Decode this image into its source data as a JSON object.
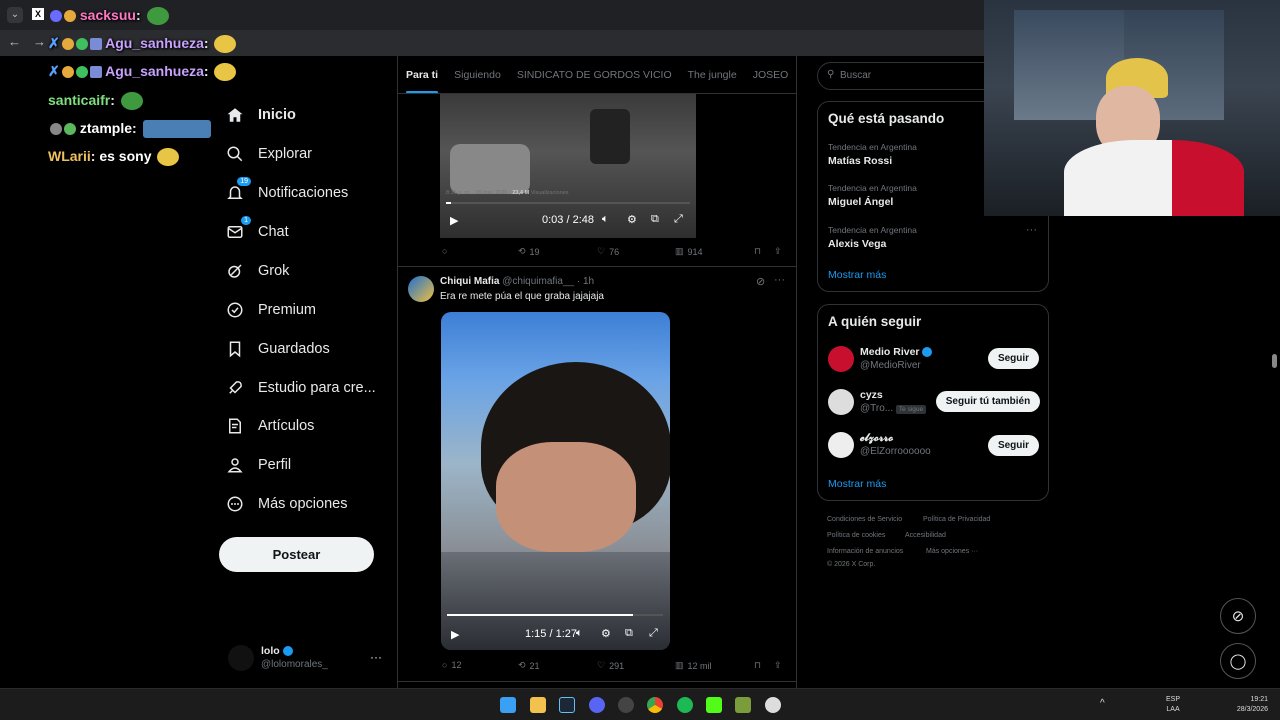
{
  "chat": [
    {
      "user": "sacksuu",
      "suffix": ":",
      "message": "",
      "color": "#ff79c6"
    },
    {
      "user": "Agu_sanhueza",
      "suffix": ":",
      "message": "",
      "color": "#c8a2ff"
    },
    {
      "user": "Agu_sanhueza",
      "suffix": ":",
      "message": "",
      "color": "#c8a2ff"
    },
    {
      "user": "santicaifr",
      "suffix": ":",
      "message": "",
      "color": "#7ee07e"
    },
    {
      "user": "ztample",
      "suffix": ":",
      "message": "",
      "color": "#ffffff"
    },
    {
      "user": "WLarii",
      "suffix": ":",
      "message": "es sony",
      "color": "#f0c060"
    }
  ],
  "nav": {
    "items": [
      {
        "label": "Inicio",
        "icon": "home-icon"
      },
      {
        "label": "Explorar",
        "icon": "search-icon"
      },
      {
        "label": "Notificaciones",
        "icon": "bell-icon",
        "badge": "19"
      },
      {
        "label": "Chat",
        "icon": "mail-icon",
        "badge": "1"
      },
      {
        "label": "Grok",
        "icon": "grok-icon"
      },
      {
        "label": "Premium",
        "icon": "premium-icon"
      },
      {
        "label": "Guardados",
        "icon": "bookmark-icon"
      },
      {
        "label": "Estudio para cre...",
        "icon": "rocket-icon"
      },
      {
        "label": "Artículos",
        "icon": "article-icon"
      },
      {
        "label": "Perfil",
        "icon": "person-icon"
      },
      {
        "label": "Más opciones",
        "icon": "more-circle-icon"
      }
    ],
    "post_label": "Postear",
    "account": {
      "name": "lolo",
      "handle": "@lolomorales_"
    }
  },
  "tabs": [
    "Para ti",
    "Siguiendo",
    "SINDICATO DE GORDOS VICIO",
    "The jungle",
    "JOSEO"
  ],
  "tweet1": {
    "video_time": "0:03 / 2:48",
    "meta_time": "8:36 p. m. · 26 mar. 2026 · ",
    "meta_views": "23,4 M",
    "meta_views_label": " Visualizaciones",
    "retweets": "19",
    "likes": "76",
    "views": "914"
  },
  "tweet2": {
    "author": "Chiqui Mafia",
    "handle": "@chiquimafia__",
    "time": "· 1h",
    "text": "Era re mete púa el que graba jajajaja",
    "video_time": "1:15 / 1:27",
    "progress": 0.86,
    "replies": "12",
    "retweets": "21",
    "likes": "291",
    "views": "12 mil"
  },
  "search": {
    "placeholder": "Buscar"
  },
  "trending": {
    "title": "Qué está pasando",
    "items": [
      {
        "meta": "Tendencia en Argentina",
        "name": "Matías Rossi"
      },
      {
        "meta": "Tendencia en Argentina",
        "name": "Miguel Ángel"
      },
      {
        "meta": "Tendencia en Argentina",
        "name": "Alexis Vega"
      }
    ],
    "show_more": "Mostrar más"
  },
  "who_to_follow": {
    "title": "A quién seguir",
    "items": [
      {
        "name": "Medio River",
        "handle": "@MedioRiver",
        "button": "Seguir",
        "tag": ""
      },
      {
        "name": "cyzs",
        "handle": "@Tro...",
        "button": "Seguir tú también",
        "tag": "Te sigue"
      },
      {
        "name": "𝓮𝓵𝔃𝓸𝓻𝓻𝓸",
        "handle": "@ElZorroooooo",
        "button": "Seguir",
        "tag": ""
      }
    ],
    "show_more": "Mostrar más"
  },
  "footer": {
    "links": [
      "Condiciones de Servicio",
      "Política de Privacidad",
      "Política de cookies",
      "Accesibilidad",
      "Información de anuncios",
      "Más opciones ···"
    ],
    "copyright": "© 2026 X Corp."
  },
  "taskbar": {
    "lang": "ESP",
    "layout": "LAA",
    "time": "19:21",
    "date": "28/3/2026"
  },
  "colors": {
    "accent": "#1d9bf0",
    "bg": "#000000",
    "border": "#2f3336"
  }
}
